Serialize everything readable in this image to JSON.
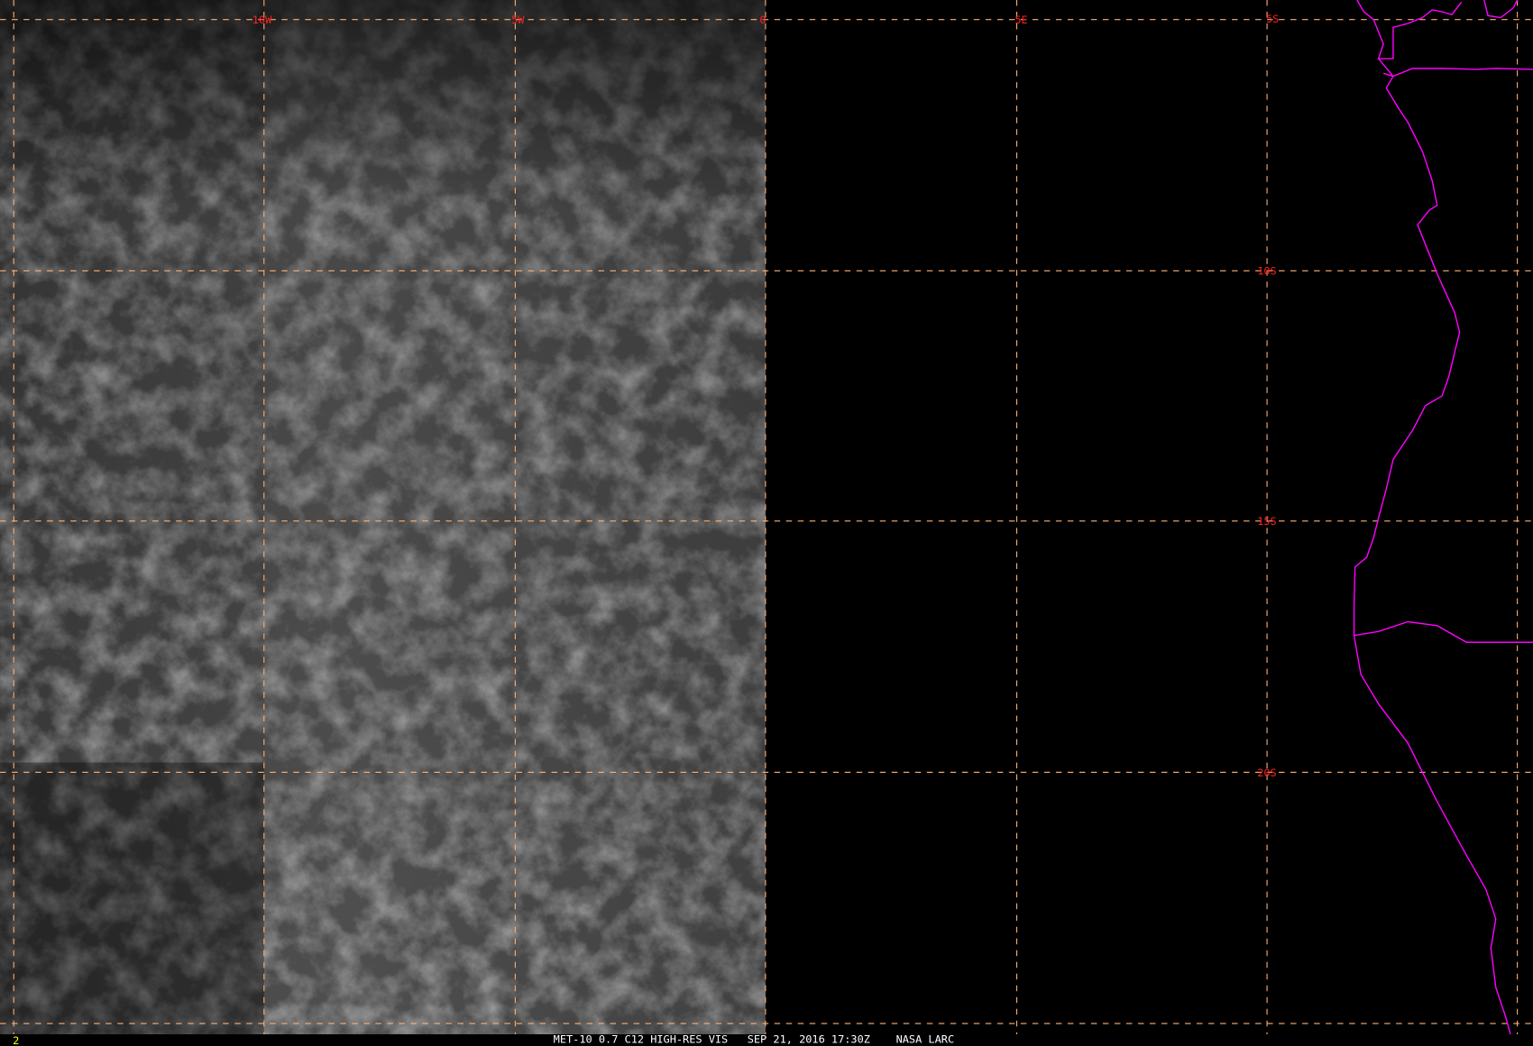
{
  "map": {
    "longitude_labels": [
      "10W",
      "5W",
      "0",
      "5E"
    ],
    "latitude_labels": [
      "5S",
      "10S",
      "15S",
      "20S"
    ],
    "frame_number": "2",
    "caption": "MET-10 0.7 C12 HIGH-RES VIS   SEP 21, 2016 17:30Z    NASA LARC",
    "colors": {
      "grid": "#ffb070",
      "labels": "#ff2020",
      "coastline": "#ff00ff",
      "frame_number": "#ffff00"
    }
  }
}
